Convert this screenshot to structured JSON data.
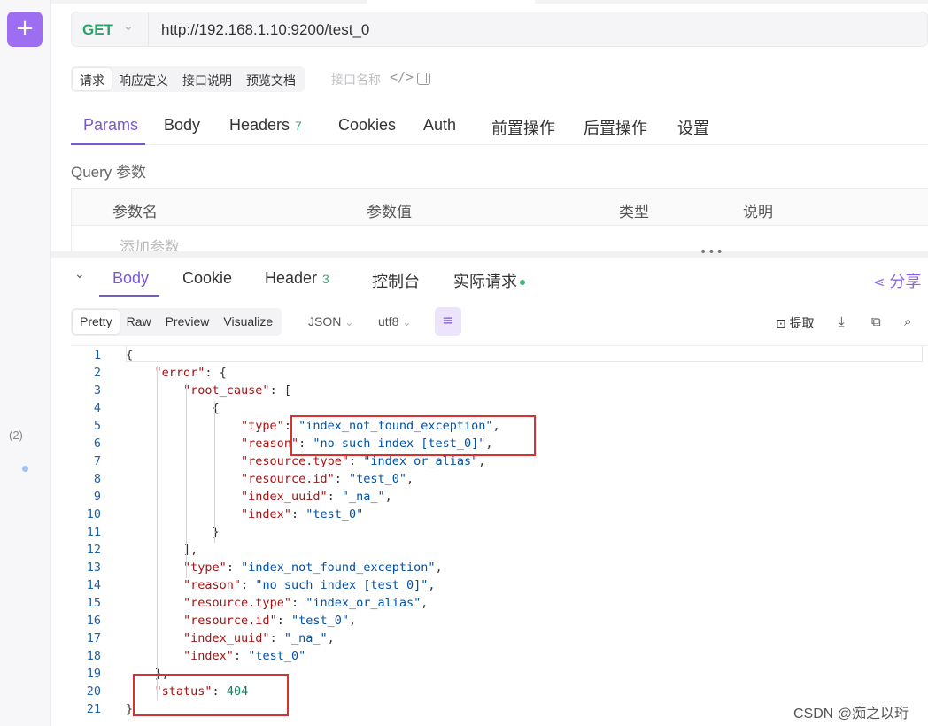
{
  "rail": {
    "add_label": "+",
    "count_label": "(2)"
  },
  "request": {
    "method": "GET",
    "url": "http://192.168.1.10:9200/test_0"
  },
  "segment": {
    "items": [
      "请求",
      "响应定义",
      "接口说明",
      "预览文档"
    ],
    "active": "请求"
  },
  "interface_name_placeholder": "接口名称",
  "code_icon": "</>",
  "req_tabs": {
    "params": "Params",
    "body": "Body",
    "headers": "Headers",
    "headers_count": "7",
    "cookies": "Cookies",
    "auth": "Auth",
    "pre": "前置操作",
    "post": "后置操作",
    "settings": "设置"
  },
  "query": {
    "title": "Query 参数",
    "columns": [
      "参数名",
      "参数值",
      "类型",
      "说明"
    ],
    "add_placeholder": "添加参数"
  },
  "divider_dots": "•••",
  "response_tabs": {
    "body": "Body",
    "cookie": "Cookie",
    "header": "Header",
    "header_count": "3",
    "console": "控制台",
    "actual": "实际请求",
    "share": "分享"
  },
  "view_modes": [
    "Pretty",
    "Raw",
    "Preview",
    "Visualize"
  ],
  "format_select": "JSON",
  "encoding_select": "utf8",
  "toolbar": {
    "extract": "提取"
  },
  "code_lines": [
    "{",
    "    \"error\": {",
    "        \"root_cause\": [",
    "            {",
    "                \"type\": \"index_not_found_exception\",",
    "                \"reason\": \"no such index [test_0]\",",
    "                \"resource.type\": \"index_or_alias\",",
    "                \"resource.id\": \"test_0\",",
    "                \"index_uuid\": \"_na_\",",
    "                \"index\": \"test_0\"",
    "            }",
    "        ],",
    "        \"type\": \"index_not_found_exception\",",
    "        \"reason\": \"no such index [test_0]\",",
    "        \"resource.type\": \"index_or_alias\",",
    "        \"resource.id\": \"test_0\",",
    "        \"index_uuid\": \"_na_\",",
    "        \"index\": \"test_0\"",
    "    },",
    "    \"status\": 404",
    "}"
  ],
  "watermark": "CSDN @痴之以珩",
  "colors": {
    "accent": "#7a57d1",
    "get": "#2aa36a",
    "annotation": "#d93030"
  }
}
